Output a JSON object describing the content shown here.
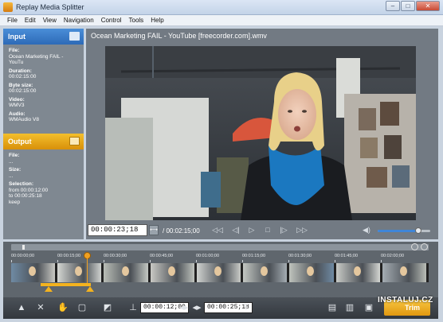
{
  "window": {
    "title": "Replay Media Splitter",
    "controls": [
      "–",
      "□",
      "✕"
    ]
  },
  "menu": [
    "File",
    "Edit",
    "View",
    "Navigation",
    "Control",
    "Tools",
    "Help"
  ],
  "input_panel": {
    "title": "Input",
    "file_label": "File:",
    "file": "Ocean Marketing FAIL - YouTu",
    "duration_label": "Duration:",
    "duration": "00:02:15:00",
    "bytesize_label": "Byte size:",
    "bytesize": "00:02:15:00",
    "video_label": "Video:",
    "video": "WMV3",
    "audio_label": "Audio:",
    "audio": "WMAudio V8"
  },
  "output_panel": {
    "title": "Output",
    "file_label": "File:",
    "file": "...",
    "size_label": "Size:",
    "size": "...",
    "selection_label": "Selection:",
    "from": "from   00:00:12:00",
    "to": "to       00:00:25:18",
    "mode": "keep"
  },
  "player": {
    "title": "Ocean Marketing FAIL - YouTube [freecorder.com].wmv",
    "current_time": "00:00:23;18",
    "duration": "/ 00:02:15;00",
    "volume": 0.78
  },
  "timeline": {
    "ticks": [
      "00:00:00;00",
      "00:00:15;00",
      "00:00:30;00",
      "00:00:45;00",
      "00:01:00;00",
      "00:01:15;00",
      "00:01:30;00",
      "00:01:45;00",
      "00:02:00;00"
    ],
    "thumbnail_count": 9
  },
  "toolbar": {
    "start_time": "00:00:12;00",
    "end_time": "00:00:25;18",
    "trim_label": "Trim"
  },
  "watermark": "INSTALUJ.CZ",
  "colors": {
    "input_header": "#3a7ec9",
    "output_header": "#f0b020",
    "accent": "#f3b21f"
  }
}
